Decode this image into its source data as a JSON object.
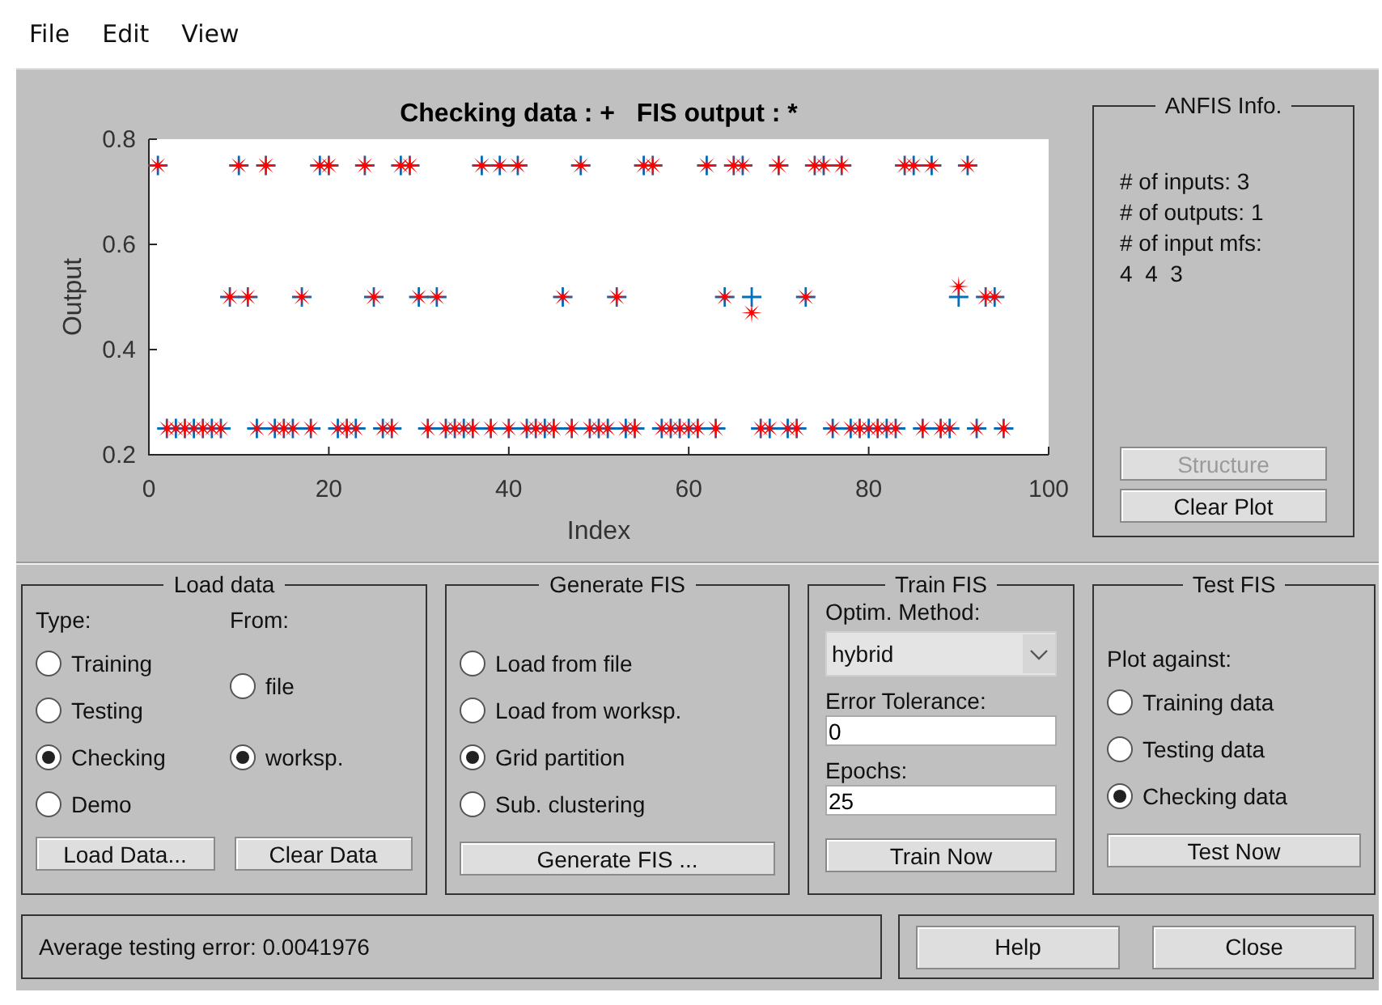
{
  "menu": [
    "File",
    "Edit",
    "View"
  ],
  "plot": {
    "chart_data": {
      "type": "scatter",
      "title": "Checking data : +   FIS output : *",
      "xlabel": "Index",
      "ylabel": "Output",
      "xlim": [
        0,
        100
      ],
      "ylim": [
        0.2,
        0.8
      ],
      "xticks": [
        0,
        20,
        40,
        60,
        80,
        100
      ],
      "yticks": [
        0.2,
        0.4,
        0.6,
        0.8
      ],
      "x": [
        1,
        2,
        3,
        4,
        5,
        6,
        7,
        8,
        9,
        10,
        11,
        12,
        13,
        14,
        15,
        16,
        17,
        18,
        19,
        20,
        21,
        22,
        23,
        24,
        25,
        26,
        27,
        28,
        29,
        30,
        31,
        32,
        33,
        34,
        35,
        36,
        37,
        38,
        39,
        40,
        41,
        42,
        43,
        44,
        45,
        46,
        47,
        48,
        49,
        50,
        51,
        52,
        53,
        54,
        55,
        56,
        57,
        58,
        59,
        60,
        61,
        62,
        63,
        64,
        65,
        66,
        67,
        68,
        69,
        70,
        71,
        72,
        73,
        74,
        75,
        76,
        77,
        78,
        79,
        80,
        81,
        82,
        83,
        84,
        85,
        86,
        87,
        88,
        89,
        90,
        91,
        92,
        93,
        94,
        95
      ],
      "series": [
        {
          "marker": "cross",
          "color": "#0072bd",
          "values": [
            0.75,
            0.25,
            0.25,
            0.25,
            0.25,
            0.25,
            0.25,
            0.25,
            0.5,
            0.75,
            0.5,
            0.25,
            0.75,
            0.25,
            0.25,
            0.25,
            0.5,
            0.25,
            0.75,
            0.75,
            0.25,
            0.25,
            0.25,
            0.75,
            0.5,
            0.25,
            0.25,
            0.75,
            0.75,
            0.5,
            0.25,
            0.5,
            0.25,
            0.25,
            0.25,
            0.25,
            0.75,
            0.25,
            0.75,
            0.25,
            0.75,
            0.25,
            0.25,
            0.25,
            0.25,
            0.5,
            0.25,
            0.75,
            0.25,
            0.25,
            0.25,
            0.5,
            0.25,
            0.25,
            0.75,
            0.75,
            0.25,
            0.25,
            0.25,
            0.25,
            0.25,
            0.75,
            0.25,
            0.5,
            0.75,
            0.75,
            0.5,
            0.25,
            0.25,
            0.75,
            0.25,
            0.25,
            0.5,
            0.75,
            0.75,
            0.25,
            0.75,
            0.25,
            0.25,
            0.25,
            0.25,
            0.25,
            0.25,
            0.75,
            0.75,
            0.25,
            0.75,
            0.25,
            0.25,
            0.5,
            0.75,
            0.25,
            0.5,
            0.5,
            0.25
          ]
        },
        {
          "marker": "star",
          "color": "#ff0000",
          "values": [
            0.75,
            0.25,
            0.25,
            0.25,
            0.25,
            0.25,
            0.25,
            0.25,
            0.5,
            0.75,
            0.5,
            0.25,
            0.75,
            0.25,
            0.25,
            0.25,
            0.5,
            0.25,
            0.75,
            0.75,
            0.25,
            0.25,
            0.25,
            0.75,
            0.5,
            0.25,
            0.25,
            0.75,
            0.75,
            0.5,
            0.25,
            0.5,
            0.25,
            0.25,
            0.25,
            0.25,
            0.75,
            0.25,
            0.75,
            0.25,
            0.75,
            0.25,
            0.25,
            0.25,
            0.25,
            0.5,
            0.25,
            0.75,
            0.25,
            0.25,
            0.25,
            0.5,
            0.25,
            0.25,
            0.75,
            0.75,
            0.25,
            0.25,
            0.25,
            0.25,
            0.25,
            0.75,
            0.25,
            0.5,
            0.75,
            0.75,
            0.47,
            0.25,
            0.25,
            0.75,
            0.25,
            0.25,
            0.5,
            0.75,
            0.75,
            0.25,
            0.75,
            0.25,
            0.25,
            0.25,
            0.25,
            0.25,
            0.25,
            0.75,
            0.75,
            0.25,
            0.75,
            0.25,
            0.25,
            0.52,
            0.75,
            0.25,
            0.5,
            0.5,
            0.25
          ]
        }
      ]
    }
  },
  "anfis_info": {
    "title": "ANFIS Info.",
    "lines": [
      "# of inputs: 3",
      "# of outputs: 1",
      "# of input mfs:",
      "4  4  3"
    ],
    "buttons": [
      {
        "label": "Structure",
        "disabled": true
      },
      {
        "label": "Clear Plot",
        "disabled": false
      }
    ]
  },
  "load_data": {
    "title": "Load data",
    "type_label": "Type:",
    "from_label": "From:",
    "type_options": [
      {
        "label": "Training",
        "selected": false
      },
      {
        "label": "Testing",
        "selected": false
      },
      {
        "label": "Checking",
        "selected": true
      },
      {
        "label": "Demo",
        "selected": false
      }
    ],
    "from_options": [
      {
        "label": "file",
        "selected": false
      },
      {
        "label": "worksp.",
        "selected": true
      }
    ],
    "buttons": [
      "Load Data...",
      "Clear Data"
    ]
  },
  "generate_fis": {
    "title": "Generate FIS",
    "options": [
      {
        "label": "Load from file",
        "selected": false
      },
      {
        "label": "Load from worksp.",
        "selected": false
      },
      {
        "label": "Grid partition",
        "selected": true
      },
      {
        "label": "Sub. clustering",
        "selected": false
      }
    ],
    "button": "Generate FIS ..."
  },
  "train_fis": {
    "title": "Train FIS",
    "method_label": "Optim. Method:",
    "method_value": "hybrid",
    "tolerance_label": "Error Tolerance:",
    "tolerance_value": "0",
    "epochs_label": "Epochs:",
    "epochs_value": "25",
    "button": "Train Now"
  },
  "test_fis": {
    "title": "Test FIS",
    "plot_against_label": "Plot against:",
    "options": [
      {
        "label": "Training data",
        "selected": false
      },
      {
        "label": "Testing data",
        "selected": false
      },
      {
        "label": "Checking data",
        "selected": true
      }
    ],
    "button": "Test Now"
  },
  "status": "Average testing error: 0.0041976",
  "dialog_buttons": [
    "Help",
    "Close"
  ]
}
